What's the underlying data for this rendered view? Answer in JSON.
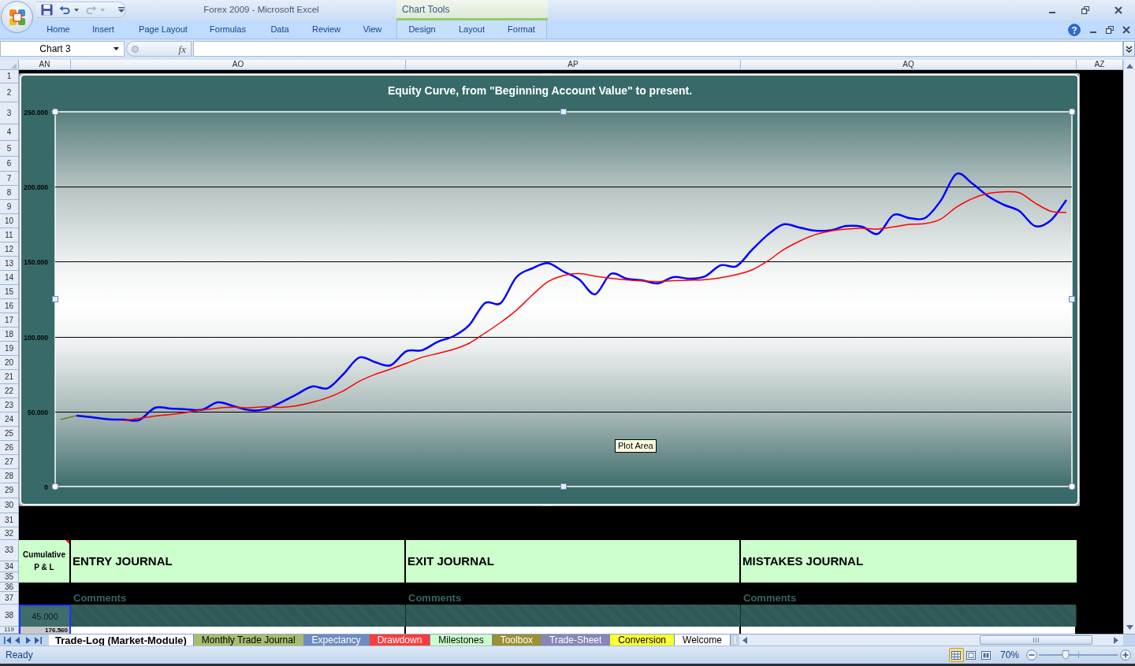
{
  "window": {
    "title": "Forex 2009 - Microsoft Excel"
  },
  "quick_access_toolbar": [
    {
      "kind": "save",
      "disabled": false
    },
    {
      "kind": "undo",
      "disabled": false
    },
    {
      "kind": "redo",
      "disabled": true
    },
    {
      "kind": "customize",
      "disabled": false
    }
  ],
  "contextual_group": {
    "title": "Chart Tools",
    "tabs": [
      "Design",
      "Layout",
      "Format"
    ]
  },
  "ribbon_tabs": [
    "Home",
    "Insert",
    "Page Layout",
    "Formulas",
    "Data",
    "Review",
    "View"
  ],
  "formula_bar": {
    "name_box": "Chart 3",
    "function_button": "fx"
  },
  "sheet": {
    "columns": [
      "AN",
      "AO",
      "AP",
      "AQ",
      "AZ"
    ],
    "rows": [
      "1",
      "2",
      "3",
      "4",
      "5",
      "6",
      "7",
      "8",
      "9",
      "10",
      "11",
      "12",
      "13",
      "14",
      "15",
      "16",
      "17",
      "18",
      "19",
      "20",
      "21",
      "22",
      "23",
      "24",
      "25",
      "26",
      "27",
      "28",
      "29",
      "30",
      "31",
      "32",
      "33",
      "34",
      "35",
      "36",
      "37",
      "38",
      "119"
    ]
  },
  "chart": {
    "chart_data": {
      "type": "line",
      "title": "Equity Curve, from \"Beginning Account Value\" to present.",
      "grid": true,
      "ylim": [
        0,
        250000
      ],
      "yticks": [
        {
          "value": 0,
          "label": "0"
        },
        {
          "value": 50000,
          "label": "50.000"
        },
        {
          "value": 100000,
          "label": "100.000"
        },
        {
          "value": 150000,
          "label": "150.000"
        },
        {
          "value": 200000,
          "label": "200.000"
        },
        {
          "value": 250000,
          "label": "250.000"
        }
      ],
      "series": [
        {
          "color": "#0000ff",
          "values": [
            null,
            47300,
            46200,
            44900,
            44600,
            44400,
            52500,
            52000,
            51500,
            51200,
            56200,
            53600,
            50900,
            51500,
            56000,
            61400,
            66700,
            65600,
            75100,
            86100,
            83000,
            80900,
            90300,
            90900,
            96600,
            100300,
            107700,
            122400,
            122400,
            139700,
            145500,
            149000,
            143400,
            138100,
            128200,
            141800,
            138700,
            137600,
            135500,
            139700,
            138700,
            140200,
            147600,
            147000,
            158000,
            168000,
            174900,
            172800,
            170700,
            171000,
            173800,
            173300,
            168600,
            181200,
            179100,
            179100,
            190700,
            208500,
            202200,
            193800,
            188000,
            183800,
            173800,
            177500,
            191200
          ]
        },
        {
          "color": "#ff0000",
          "values": [
            null,
            null,
            null,
            null,
            44000,
            45400,
            47000,
            48100,
            49400,
            51100,
            52300,
            52900,
            52500,
            53200,
            52800,
            53900,
            56200,
            59300,
            63900,
            70200,
            74800,
            78400,
            82200,
            86200,
            88800,
            91500,
            95600,
            102400,
            109500,
            117600,
            127600,
            136600,
            140800,
            142000,
            140400,
            138900,
            137900,
            137200,
            136700,
            137400,
            137600,
            138000,
            139300,
            141400,
            144600,
            150500,
            158000,
            163600,
            168000,
            170500,
            171700,
            172300,
            171800,
            173200,
            174900,
            175400,
            178400,
            186400,
            192000,
            195500,
            196600,
            196000,
            189200,
            183700,
            182800
          ]
        },
        {
          "color": "#6b7f2f",
          "values": [
            44600,
            47300,
            null,
            null,
            null,
            null,
            null,
            null,
            null,
            null,
            null,
            null,
            null,
            null,
            null,
            null,
            null,
            null,
            null,
            null,
            null,
            null,
            null,
            null,
            null,
            null,
            null,
            null,
            null,
            null,
            null,
            null,
            null,
            null,
            null,
            null,
            null,
            null,
            null,
            null,
            null,
            null,
            null,
            null,
            null,
            null,
            null,
            null,
            null,
            null,
            null,
            null,
            null,
            null,
            null,
            null,
            null,
            null,
            null,
            null,
            null,
            null,
            null,
            null,
            null
          ]
        }
      ]
    },
    "tooltip": "Plot Area"
  },
  "journal": {
    "header_cells": [
      {
        "text": "Cumulative P & L",
        "comment": true
      },
      {
        "text": "ENTRY JOURNAL",
        "comment": false
      },
      {
        "text": "EXIT JOURNAL",
        "comment": false
      },
      {
        "text": "MISTAKES JOURNAL",
        "comment": false
      }
    ],
    "comment_labels": [
      "Comments",
      "Comments",
      "Comments"
    ],
    "value_rows": [
      {
        "value": "45.000",
        "highlighted": true
      },
      {
        "value": "176.560",
        "highlighted": true
      }
    ]
  },
  "sheet_tabs": [
    {
      "label": "Trade-Log (Market-Module)",
      "selected": true
    },
    {
      "label": "Monthly Trade Journal",
      "selected": false,
      "color": "#a9bd6e"
    },
    {
      "label": "Expectancy",
      "selected": false,
      "color": "#6f8cc0"
    },
    {
      "label": "Drawdown",
      "selected": false,
      "color": "#ff3b3b"
    },
    {
      "label": "Milestones",
      "selected": false,
      "color": "#ccffcc"
    },
    {
      "label": "Toolbox",
      "selected": false,
      "color": "#9c9030"
    },
    {
      "label": "Trade-Sheet",
      "selected": false,
      "color": "#8886b6"
    },
    {
      "label": "Conversion",
      "selected": false,
      "color": "#ffff33"
    },
    {
      "label": "Welcome",
      "selected": false
    }
  ],
  "status_bar": {
    "text": "Ready",
    "views": [
      {
        "kind": "normal",
        "selected": true
      },
      {
        "kind": "page-layout",
        "selected": false
      },
      {
        "kind": "page-break",
        "selected": false
      }
    ],
    "zoom": {
      "reading": "70%",
      "level": 0.34
    }
  }
}
